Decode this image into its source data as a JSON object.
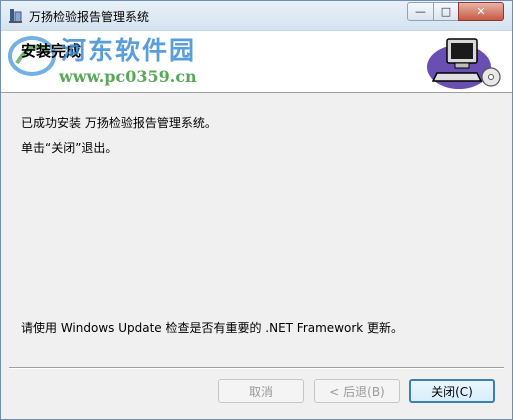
{
  "window": {
    "title": "万扬检验报告管理系统",
    "caption_buttons": {
      "minimize": "—",
      "maximize": "□",
      "close": "✕"
    }
  },
  "banner": {
    "title": "安装完成",
    "watermark_name": "河东软件园",
    "watermark_url": "www.pc0359.cn"
  },
  "content": {
    "line1": "已成功安装 万扬检验报告管理系统。",
    "line2": "单击“关闭”退出。",
    "line3": "请使用 Windows Update 检查是否有重要的 .NET Framework 更新。"
  },
  "buttons": {
    "cancel": "取消",
    "back": "< 后退(B)",
    "close": "关闭(C)"
  },
  "colors": {
    "accent": "#3c7fb1",
    "watermark_blue": "#3b8ed6",
    "watermark_green": "#3d9a3d"
  },
  "icons": [
    "app-icon",
    "computer-icon",
    "watermark-logo-icon"
  ]
}
